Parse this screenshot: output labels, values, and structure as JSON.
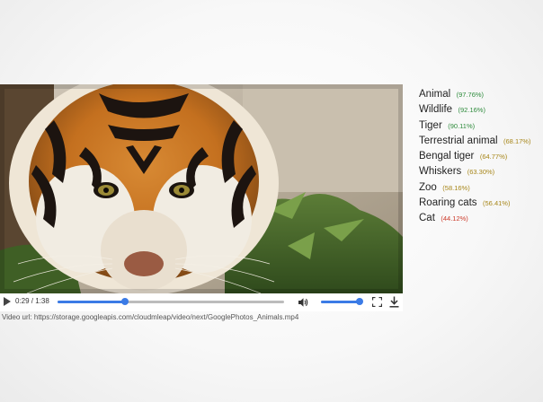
{
  "player": {
    "time_current": "0:29",
    "time_total": "1:38",
    "progress_fraction": 0.296,
    "volume_fraction": 0.97,
    "video_url": "Video url: https://storage.googleapis.com/cloudmleap/video/next/GooglePhotos_Animals.mp4"
  },
  "icons": {
    "play": "play-icon",
    "volume": "volume-icon",
    "fullscreen": "fullscreen-icon",
    "download": "download-icon"
  },
  "colors": {
    "progress": "#3b7be6",
    "score_high": "#2e8b3c",
    "score_mid": "#a78619",
    "score_low": "#cc3b2b"
  },
  "labels": [
    {
      "name": "Animal",
      "score": "(97.76%)",
      "level": "high"
    },
    {
      "name": "Wildlife",
      "score": "(92.16%)",
      "level": "high"
    },
    {
      "name": "Tiger",
      "score": "(90.11%)",
      "level": "high"
    },
    {
      "name": "Terrestrial animal",
      "score": "(68.17%)",
      "level": "mid"
    },
    {
      "name": "Bengal tiger",
      "score": "(64.77%)",
      "level": "mid"
    },
    {
      "name": "Whiskers",
      "score": "(63.30%)",
      "level": "mid"
    },
    {
      "name": "Zoo",
      "score": "(58.16%)",
      "level": "mid"
    },
    {
      "name": "Roaring cats",
      "score": "(56.41%)",
      "level": "mid"
    },
    {
      "name": "Cat",
      "score": "(44.12%)",
      "level": "low"
    }
  ]
}
